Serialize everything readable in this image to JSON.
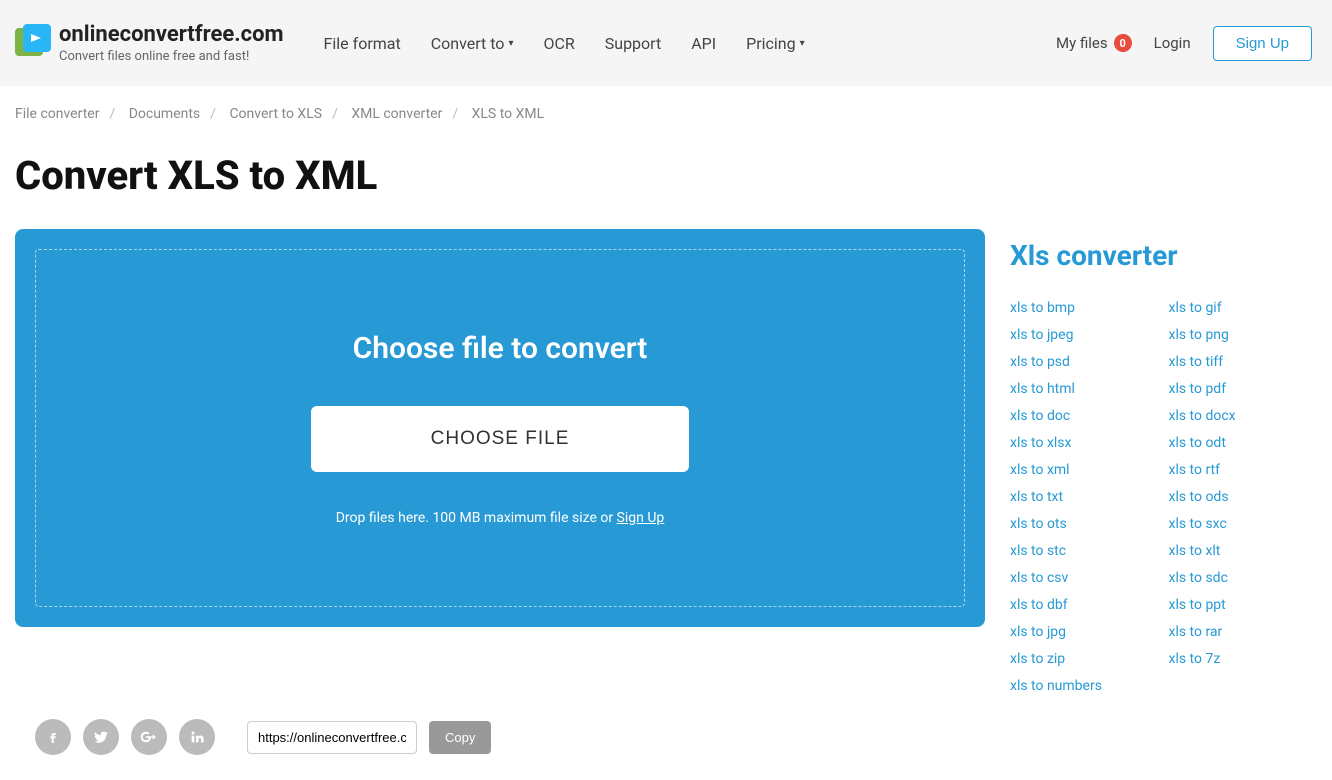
{
  "header": {
    "logo_name": "onlineconvertfree.com",
    "logo_tagline": "Convert files online free and fast!",
    "nav": {
      "file_format": "File format",
      "convert_to": "Convert to",
      "ocr": "OCR",
      "support": "Support",
      "api": "API",
      "pricing": "Pricing"
    },
    "my_files": "My files",
    "my_files_count": "0",
    "login": "Login",
    "signup": "Sign Up"
  },
  "breadcrumb": {
    "b1": "File converter",
    "b2": "Documents",
    "b3": "Convert to XLS",
    "b4": "XML converter",
    "b5": "XLS to XML"
  },
  "page_title": "Convert XLS to XML",
  "dropzone": {
    "title": "Choose file to convert",
    "button": "CHOOSE FILE",
    "hint_prefix": "Drop files here. 100 MB maximum file size or ",
    "hint_link": "Sign Up"
  },
  "sidebar": {
    "title": "Xls converter",
    "links_col1": [
      "xls to bmp",
      "xls to jpeg",
      "xls to psd",
      "xls to html",
      "xls to doc",
      "xls to xlsx",
      "xls to xml",
      "xls to txt",
      "xls to ots",
      "xls to stc",
      "xls to csv",
      "xls to dbf",
      "xls to jpg",
      "xls to zip",
      "xls to numbers"
    ],
    "links_col2": [
      "xls to gif",
      "xls to png",
      "xls to tiff",
      "xls to pdf",
      "xls to docx",
      "xls to odt",
      "xls to rtf",
      "xls to ods",
      "xls to sxc",
      "xls to xlt",
      "xls to sdc",
      "xls to ppt",
      "xls to rar",
      "xls to 7z"
    ]
  },
  "share": {
    "url_value": "https://onlineconvertfree.c",
    "copy": "Copy"
  }
}
